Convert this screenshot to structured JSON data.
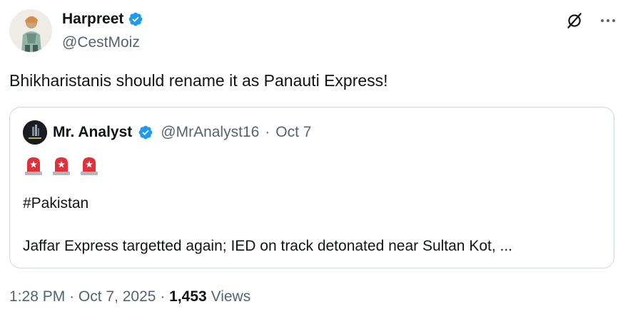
{
  "author": {
    "display_name": "Harpreet",
    "handle": "@CestMoiz",
    "verified": true
  },
  "tweet": {
    "text": "Bhikharistanis should rename it as Panauti Express!"
  },
  "quoted_tweet": {
    "display_name": "Mr. Analyst",
    "handle": "@MrAnalyst16",
    "separator": "·",
    "date": "Oct 7",
    "verified": true,
    "emojis": [
      "siren-icon",
      "siren-icon",
      "siren-icon"
    ],
    "hashtag": "#Pakistan",
    "body": "Jaffar Express targetted again; IED on track detonated near Sultan Kot, ..."
  },
  "meta": {
    "time": "1:28 PM",
    "separator1": "·",
    "date": "Oct 7, 2025",
    "separator2": "·",
    "views_count": "1,453",
    "views_label": "Views"
  },
  "colors": {
    "text_primary": "#0f1419",
    "text_secondary": "#536471",
    "verified_blue": "#1d9bf0",
    "border": "#cfd9de"
  }
}
